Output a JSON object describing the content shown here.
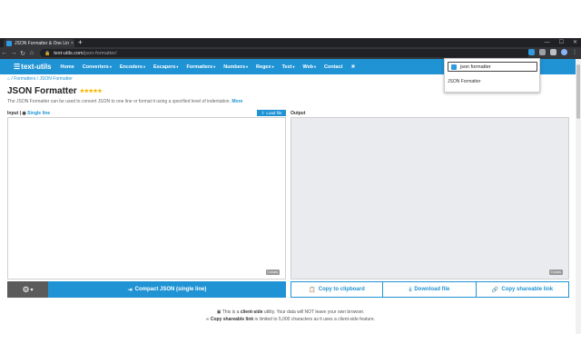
{
  "browser": {
    "tab_title": "JSON Formatter & One Line - Co",
    "tab_close": "×",
    "new_tab": "+",
    "url_host": "text-utils.com",
    "url_path": "/json-formatter/"
  },
  "site": {
    "logo": "text-utils",
    "nav": [
      {
        "label": "Home",
        "caret": false
      },
      {
        "label": "Converters",
        "caret": true
      },
      {
        "label": "Encoders",
        "caret": true
      },
      {
        "label": "Escapers",
        "caret": true
      },
      {
        "label": "Formatters",
        "caret": true
      },
      {
        "label": "Numbers",
        "caret": true
      },
      {
        "label": "Regex",
        "caret": true
      },
      {
        "label": "Text",
        "caret": true
      },
      {
        "label": "Web",
        "caret": true
      },
      {
        "label": "Contact",
        "caret": false
      }
    ]
  },
  "search": {
    "value": "json formatter",
    "result": "JSON Formatter"
  },
  "breadcrumb": {
    "home": "⌂",
    "sep1": "/",
    "formatters": "Formatters",
    "sep2": "/",
    "current": "JSON Formatter"
  },
  "page": {
    "title": "JSON Formatter",
    "stars": "★★★★★",
    "description": "The JSON Formatter can be used to convert JSON to one line or format it using a specified level of indentation.",
    "more": "More"
  },
  "editor": {
    "input_label": "Input",
    "single_line": "Single line",
    "load_file": "Load file",
    "output_label": "Output",
    "input_badge": "0 chars",
    "output_badge": "0 chars"
  },
  "actions": {
    "compact": "Compact JSON (single line)",
    "copy": "Copy to clipboard",
    "download": "Download file",
    "share": "Copy shareable link"
  },
  "notes": {
    "line1_pre": "This is a",
    "line1_bold": "client-side",
    "line1_post": "utility. Your data will NOT leave your own browser.",
    "line2_bold": "Copy shareable link",
    "line2_post": "is limited to 5,000 characters as it uses a client-side feature."
  },
  "colors": {
    "brand": "#1f93d4",
    "star": "#f5b800"
  }
}
